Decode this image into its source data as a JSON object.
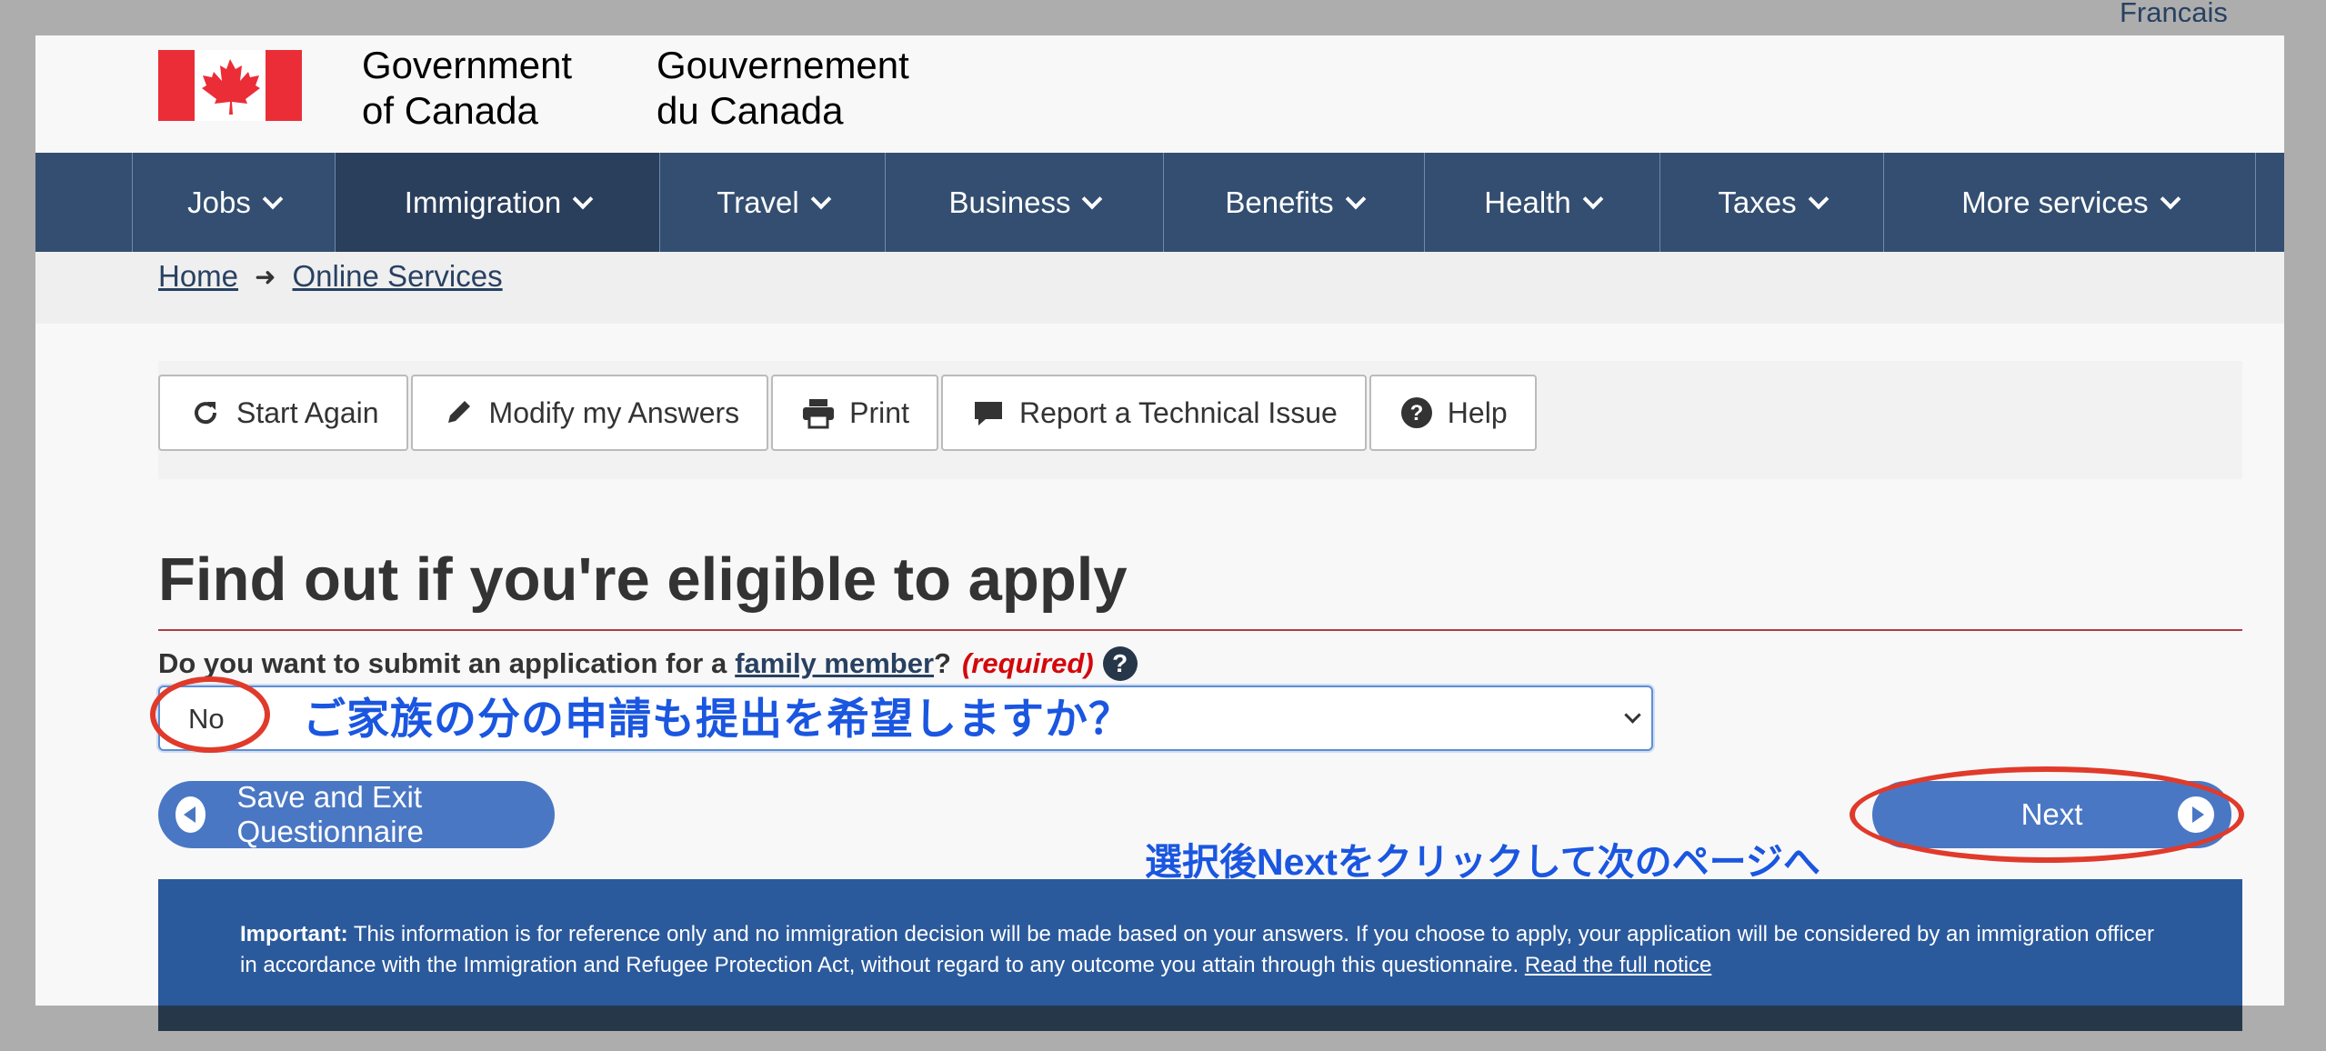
{
  "language_toggle": "Français",
  "header": {
    "signature_en_line1": "Government",
    "signature_en_line2": "of Canada",
    "signature_fr_line1": "Gouvernement",
    "signature_fr_line2": "du Canada",
    "flag_icon": "canada-flag-icon"
  },
  "menu": {
    "items": [
      {
        "label": "Jobs"
      },
      {
        "label": "Immigration"
      },
      {
        "label": "Travel"
      },
      {
        "label": "Business"
      },
      {
        "label": "Benefits"
      },
      {
        "label": "Health"
      },
      {
        "label": "Taxes"
      },
      {
        "label": "More services"
      }
    ],
    "active_index": 1,
    "colors": {
      "band": "#334e70",
      "active": "#2a3f5c"
    }
  },
  "breadcrumb": {
    "items": [
      {
        "label": "Home"
      },
      {
        "label": "Online Services"
      }
    ],
    "separator_icon": "arrow-right-icon"
  },
  "toolbar": {
    "start_again": "Start Again",
    "modify": "Modify my Answers",
    "print": "Print",
    "report": "Report a Technical Issue",
    "help": "Help"
  },
  "page": {
    "title": "Find out if you're eligible to apply"
  },
  "question": {
    "label_before": "Do you want to submit an application for a",
    "label_link": "family member",
    "label_after": "?",
    "required": "(required)",
    "help_glyph": "?",
    "selected_value": "No"
  },
  "annotations": {
    "select_note": "ご家族の分の申請も提出を希望しますか？",
    "next_note": "選択後Nextをクリックして次のページへ",
    "circle_color": "#e03a2b",
    "text_color": "#1a56e0"
  },
  "actions": {
    "save_exit": "Save and Exit Questionnaire",
    "next": "Next"
  },
  "notice": {
    "label": "Important:",
    "body": " This information is for reference only and no immigration decision will be made based on your answers. If you choose to apply, your application will be considered by an immigration officer in accordance with the Immigration and Refugee Protection Act, without regard to any outcome you attain through this questionnaire. ",
    "link": "Read the full notice"
  }
}
